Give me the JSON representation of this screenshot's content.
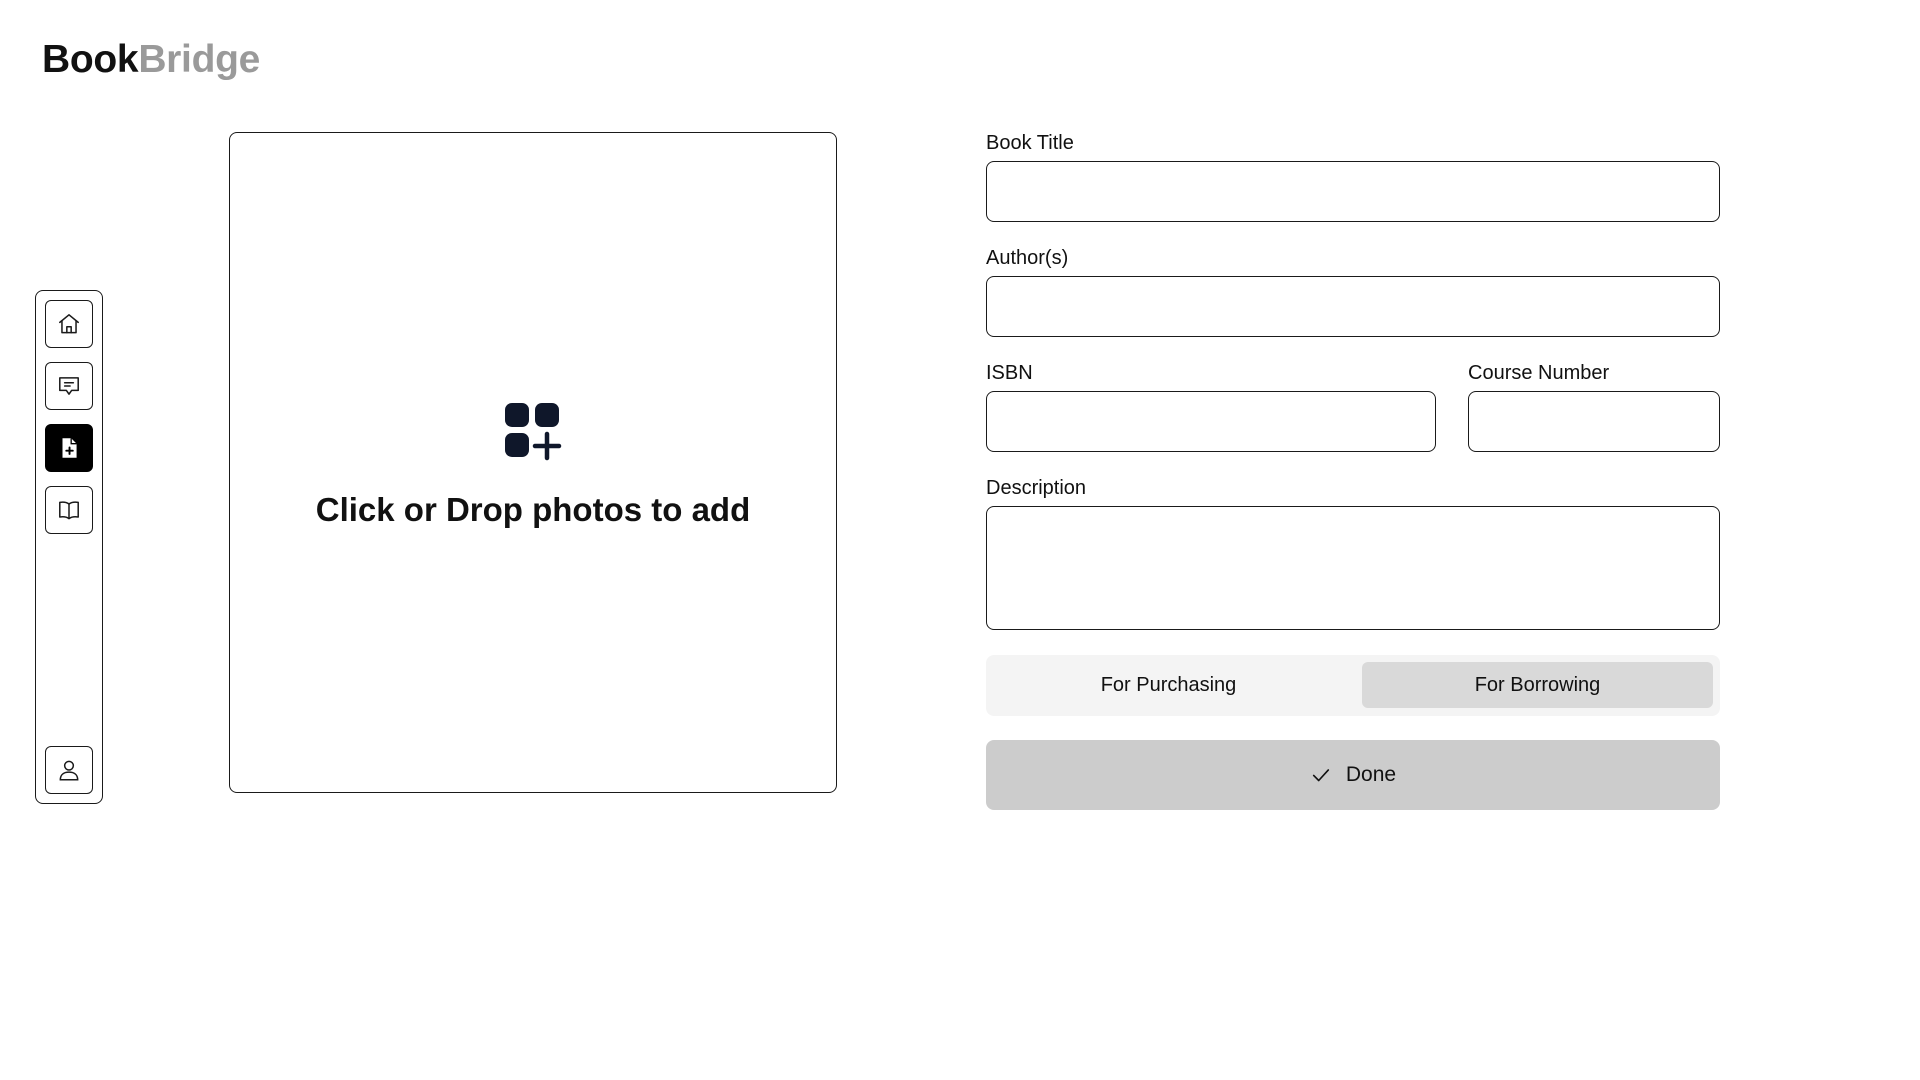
{
  "brand": {
    "part1": "Book",
    "part2": "Bridge",
    "part2_color": "#9a9a9a"
  },
  "sidebar": {
    "items": [
      {
        "name": "home",
        "icon": "home-icon",
        "active": false
      },
      {
        "name": "messages",
        "icon": "chat-icon",
        "active": false
      },
      {
        "name": "new-listing",
        "icon": "file-plus-icon",
        "active": true
      },
      {
        "name": "library",
        "icon": "book-open-icon",
        "active": false
      }
    ],
    "profile": {
      "icon": "user-icon"
    }
  },
  "upload": {
    "icon": "apps-add-icon",
    "text": "Click or Drop photos to add"
  },
  "form": {
    "book_title": {
      "label": "Book Title",
      "value": "",
      "placeholder": ""
    },
    "authors": {
      "label": "Author(s)",
      "value": "",
      "placeholder": ""
    },
    "isbn": {
      "label": "ISBN",
      "value": "",
      "placeholder": ""
    },
    "course_number": {
      "label": "Course Number",
      "value": "",
      "placeholder": ""
    },
    "description": {
      "label": "Description",
      "value": "",
      "placeholder": ""
    },
    "listing_type": {
      "options": [
        "For Purchasing",
        "For Borrowing"
      ],
      "selected": "For Borrowing"
    },
    "done_button": {
      "label": "Done",
      "icon": "check-icon"
    }
  },
  "colors": {
    "accent": "#000000",
    "button_bg": "#cccccc",
    "toggle_bg": "#f4f4f4",
    "toggle_selected": "#d9d9d9"
  }
}
